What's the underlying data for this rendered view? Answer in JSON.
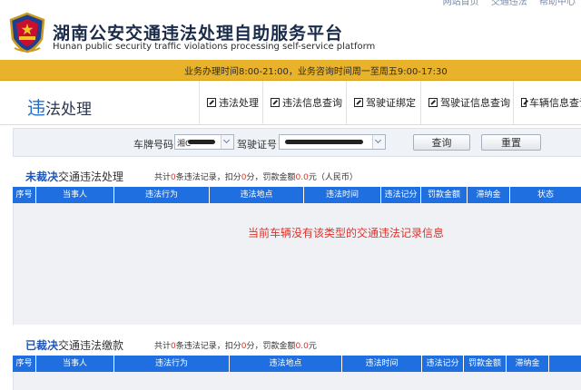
{
  "header": {
    "title": "湖南公安交通违法处理自助服务平台",
    "subtitle": "Hunan public security traffic violations processing self-service platform",
    "top_links": [
      "网站首页",
      "交通违法",
      "帮助中心"
    ]
  },
  "notice": {
    "text": "业务办理时间8:00-21:00，业务咨询时间周一至周五9:00-17:30"
  },
  "nav": {
    "page_title_highlight": "违",
    "page_title_rest": "法处理",
    "tabs": [
      {
        "label": "违法处理"
      },
      {
        "label": "违法信息查询"
      },
      {
        "label": "驾驶证绑定"
      },
      {
        "label": "驾驶证信息查询"
      },
      {
        "label": "车辆信息查询"
      }
    ]
  },
  "search": {
    "plate_label": "车牌号码",
    "plate_value": "湘C",
    "license_label": "驾驶证号",
    "query_label": "查询",
    "reset_label": "重置"
  },
  "unresolved": {
    "title_strong": "未裁决",
    "title_rest": "交通违法处理",
    "summary_prefix": "共计",
    "count": "0",
    "summary_mid1": "条违法记录，扣分",
    "points": "0",
    "summary_mid2": "分，罚款金额",
    "fine": "0.0",
    "summary_suffix": "元（人民币）",
    "columns": [
      "序号",
      "当事人",
      "违法行为",
      "违法地点",
      "违法时间",
      "违法记分",
      "罚款金额",
      "滞纳金",
      "状态"
    ],
    "empty_message": "当前车辆没有该类型的交通违法记录信息"
  },
  "resolved": {
    "title_strong": "已裁决",
    "title_rest": "交通违法缴款",
    "summary_prefix": "共计",
    "count": "0",
    "summary_mid1": "条违法记录，扣分",
    "points": "0",
    "summary_mid2": "分，罚款金额",
    "fine": "0.0",
    "summary_suffix": "元",
    "columns": [
      "序号",
      "当事人",
      "违法行为",
      "违法地点",
      "违法时间",
      "违法记分",
      "罚款金额",
      "滞纳金"
    ]
  },
  "colors": {
    "primary_blue": "#1f6fe0",
    "notice_yellow": "#e8b32a",
    "alert_red": "#e0312a"
  },
  "icons": {
    "emblem": "police-emblem-icon",
    "tab": "external-link-icon",
    "dropdown": "chevron-down-icon"
  }
}
